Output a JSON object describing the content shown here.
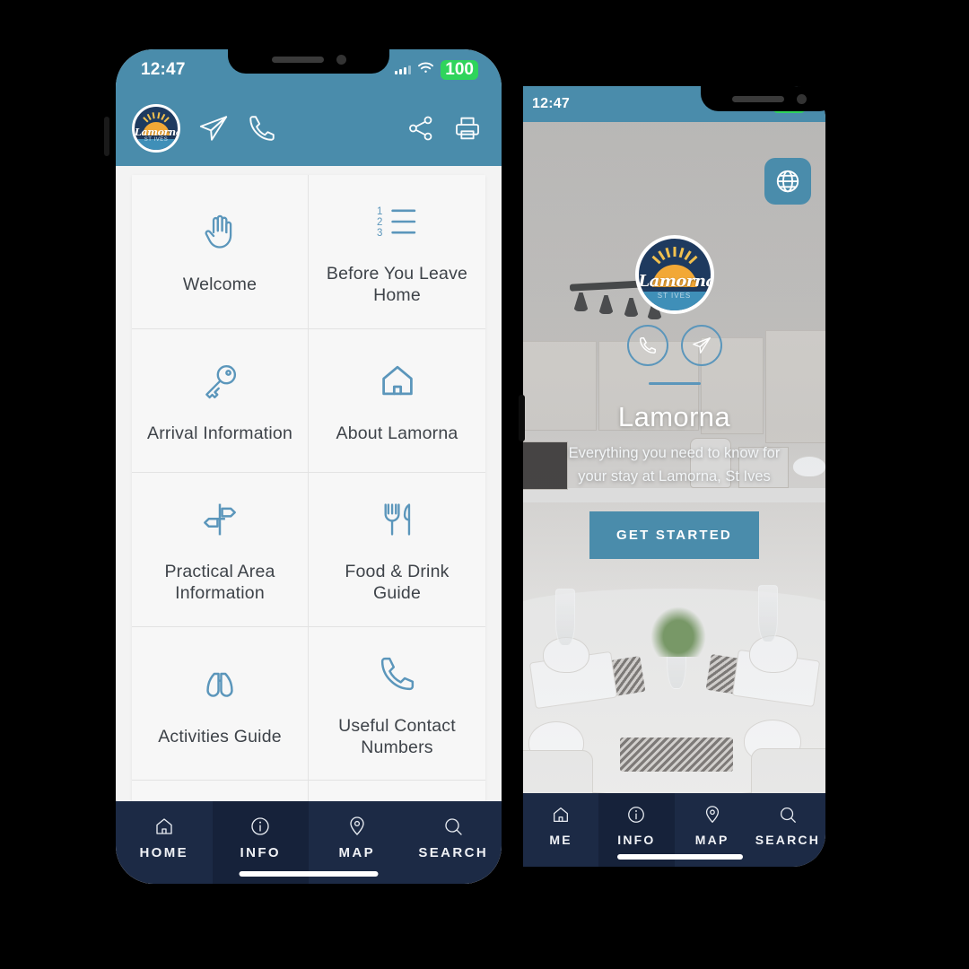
{
  "status": {
    "time": "12:47",
    "battery": "100",
    "signal_icon": "signal-bars-icon",
    "wifi_icon": "wifi-icon"
  },
  "colors": {
    "accent_teal": "#4a8cab",
    "navy": "#1c2a45",
    "navy_active": "#16223a",
    "icon_blue": "#5b96bb",
    "battery_green": "#2fd45c"
  },
  "left_phone": {
    "appbar": {
      "logo_word": "Lamorna",
      "logo_sub": "ST IVES",
      "send_icon": "paper-plane-icon",
      "phone_icon": "phone-icon",
      "share_icon": "share-nodes-icon",
      "print_icon": "printer-icon"
    },
    "menu": [
      {
        "label": "Welcome",
        "icon": "hand-wave-icon"
      },
      {
        "label": "Before You Leave Home",
        "icon": "numbered-list-icon"
      },
      {
        "label": "Arrival Information",
        "icon": "key-icon"
      },
      {
        "label": "About Lamorna",
        "icon": "house-icon"
      },
      {
        "label": "Practical Area Information",
        "icon": "signpost-icon"
      },
      {
        "label": "Food & Drink Guide",
        "icon": "fork-knife-icon"
      },
      {
        "label": "Activities Guide",
        "icon": "binoculars-icon"
      },
      {
        "label": "Useful Contact Numbers",
        "icon": "phone-call-icon"
      },
      {
        "label": "",
        "icon": "open-book-icon"
      },
      {
        "label": "",
        "icon": "suitcase-icon"
      }
    ],
    "tabs": [
      {
        "label": "HOME",
        "icon": "home-icon",
        "active": false
      },
      {
        "label": "INFO",
        "icon": "info-circle-icon",
        "active": true
      },
      {
        "label": "MAP",
        "icon": "map-pin-icon",
        "active": false
      },
      {
        "label": "SEARCH",
        "icon": "search-icon",
        "active": false
      }
    ]
  },
  "right_phone": {
    "globe_icon": "globe-icon",
    "logo_word": "Lamorna",
    "logo_sub": "ST IVES",
    "phone_icon": "phone-icon",
    "send_icon": "paper-plane-icon",
    "title": "Lamorna",
    "subtitle": "Everything you need to know for your stay at Lamorna, St Ives",
    "cta_label": "GET STARTED",
    "tabs": [
      {
        "label": "ME",
        "icon": "home-icon",
        "active": false
      },
      {
        "label": "INFO",
        "icon": "info-circle-icon",
        "active": true
      },
      {
        "label": "MAP",
        "icon": "map-pin-icon",
        "active": false
      },
      {
        "label": "SEARCH",
        "icon": "search-icon",
        "active": false
      }
    ]
  }
}
